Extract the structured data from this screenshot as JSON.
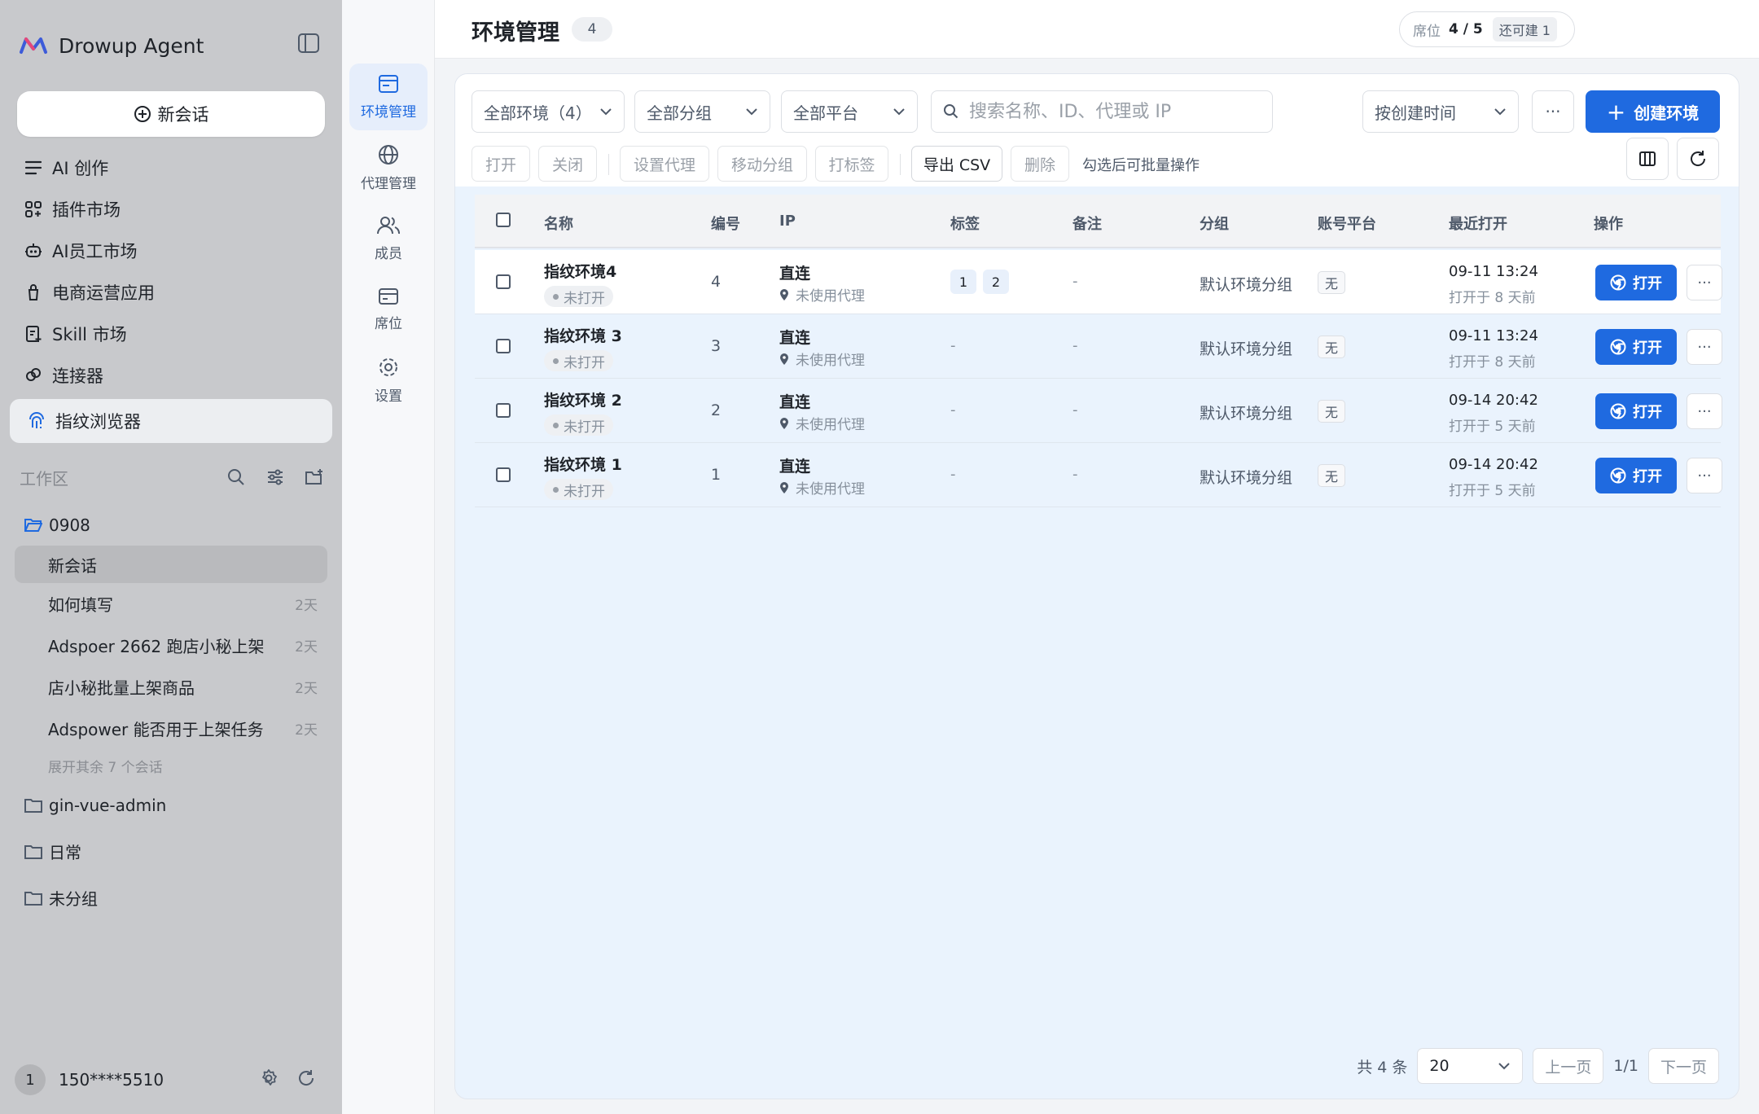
{
  "brand": {
    "name": "Drowup Agent"
  },
  "sidebar": {
    "new_chat": "新会话",
    "nav": [
      {
        "label": "AI 创作",
        "icon": "list-icon"
      },
      {
        "label": "插件市场",
        "icon": "grid-plus-icon"
      },
      {
        "label": "AI员工市场",
        "icon": "robot-icon"
      },
      {
        "label": "电商运营应用",
        "icon": "shopping-bag-icon"
      },
      {
        "label": "Skill 市场",
        "icon": "doc-plus-icon"
      },
      {
        "label": "连接器",
        "icon": "connector-icon"
      },
      {
        "label": "指纹浏览器",
        "icon": "fingerprint-icon",
        "active": true
      }
    ],
    "workspace": {
      "title": "工作区",
      "folder_0908": "0908",
      "sessions": [
        {
          "title": "新会话",
          "age": ""
        },
        {
          "title": "如何填写",
          "age": "2天"
        },
        {
          "title": "Adspoer 2662 跑店小秘上架",
          "age": "2天"
        },
        {
          "title": "店小秘批量上架商品",
          "age": "2天"
        },
        {
          "title": "Adspower 能否用于上架任务",
          "age": "2天"
        }
      ],
      "more_sessions": "展开其余 7 个会话",
      "folders": [
        "gin-vue-admin",
        "日常",
        "未分组"
      ]
    },
    "user": {
      "badge": "1",
      "name": "150****5510"
    }
  },
  "rail": [
    {
      "label": "环境管理",
      "active": true
    },
    {
      "label": "代理管理"
    },
    {
      "label": "成员"
    },
    {
      "label": "席位"
    },
    {
      "label": "设置"
    }
  ],
  "header": {
    "title": "环境管理",
    "count": "4",
    "seat_label": "席位",
    "seat_value": "4 / 5",
    "seat_badge": "还可建 1"
  },
  "filters": {
    "env": "全部环境（4）",
    "group": "全部分组",
    "platform": "全部平台",
    "search_placeholder": "搜索名称、ID、代理或 IP",
    "sort": "按创建时间",
    "more": "···",
    "create": "创建环境"
  },
  "batch": {
    "open": "打开",
    "close": "关闭",
    "set_proxy": "设置代理",
    "move_group": "移动分组",
    "tag": "打标签",
    "export": "导出 CSV",
    "delete": "删除",
    "hint": "勾选后可批量操作"
  },
  "table": {
    "columns": [
      "名称",
      "编号",
      "IP",
      "标签",
      "备注",
      "分组",
      "账号平台",
      "最近打开",
      "操作"
    ],
    "rows": [
      {
        "name": "指纹环境4",
        "status": "未打开",
        "num": "4",
        "ip": "直连",
        "proxy": "未使用代理",
        "tags": [
          "1",
          "2"
        ],
        "tag_dash": "",
        "note": "-",
        "group": "默认环境分组",
        "platform": "无",
        "time": "09-11 13:24",
        "ago": "打开于 8 天前",
        "open": "打开",
        "more": "···"
      },
      {
        "name": "指纹环境 3",
        "status": "未打开",
        "num": "3",
        "ip": "直连",
        "proxy": "未使用代理",
        "tags": [],
        "tag_dash": "-",
        "note": "-",
        "group": "默认环境分组",
        "platform": "无",
        "time": "09-11 13:24",
        "ago": "打开于 8 天前",
        "open": "打开",
        "more": "···"
      },
      {
        "name": "指纹环境 2",
        "status": "未打开",
        "num": "2",
        "ip": "直连",
        "proxy": "未使用代理",
        "tags": [],
        "tag_dash": "-",
        "note": "-",
        "group": "默认环境分组",
        "platform": "无",
        "time": "09-14 20:42",
        "ago": "打开于 5 天前",
        "open": "打开",
        "more": "···"
      },
      {
        "name": "指纹环境 1",
        "status": "未打开",
        "num": "1",
        "ip": "直连",
        "proxy": "未使用代理",
        "tags": [],
        "tag_dash": "-",
        "note": "-",
        "group": "默认环境分组",
        "platform": "无",
        "time": "09-14 20:42",
        "ago": "打开于 5 天前",
        "open": "打开",
        "more": "···"
      }
    ]
  },
  "pager": {
    "total": "共 4 条",
    "size": "20",
    "prev": "上一页",
    "page": "1/1",
    "next": "下一页"
  },
  "colors": {
    "accent": "#1f6ae0",
    "sidebar_bg": "#c8c9cc",
    "card_bg": "#eaf3fd"
  }
}
